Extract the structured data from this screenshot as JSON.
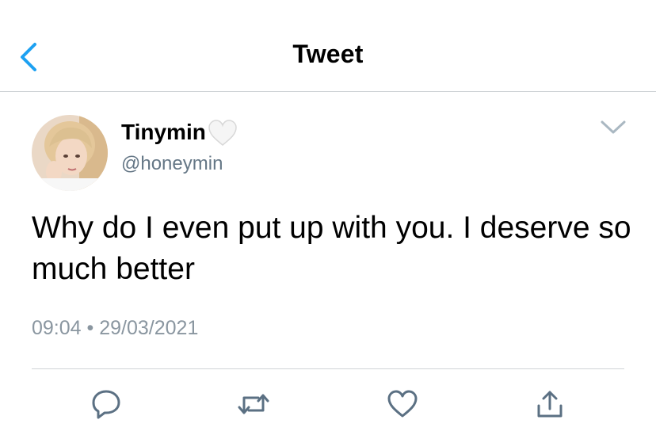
{
  "header": {
    "title": "Tweet",
    "back_icon": "chevron-left-icon",
    "accent_color": "#1da1f2"
  },
  "tweet": {
    "display_name": "Tinymin",
    "name_emoji": "white-heart-icon",
    "handle": "@honeymin",
    "text": "Why do I even put up with you. I deserve so much better",
    "time": "09:04",
    "separator": "•",
    "date": "29/03/2021"
  },
  "actions": [
    {
      "icon": "reply-icon"
    },
    {
      "icon": "retweet-icon"
    },
    {
      "icon": "like-icon"
    },
    {
      "icon": "share-icon"
    }
  ],
  "colors": {
    "action_icon": "#5b7083",
    "secondary_text": "#657786",
    "divider": "#cfd3d6"
  }
}
